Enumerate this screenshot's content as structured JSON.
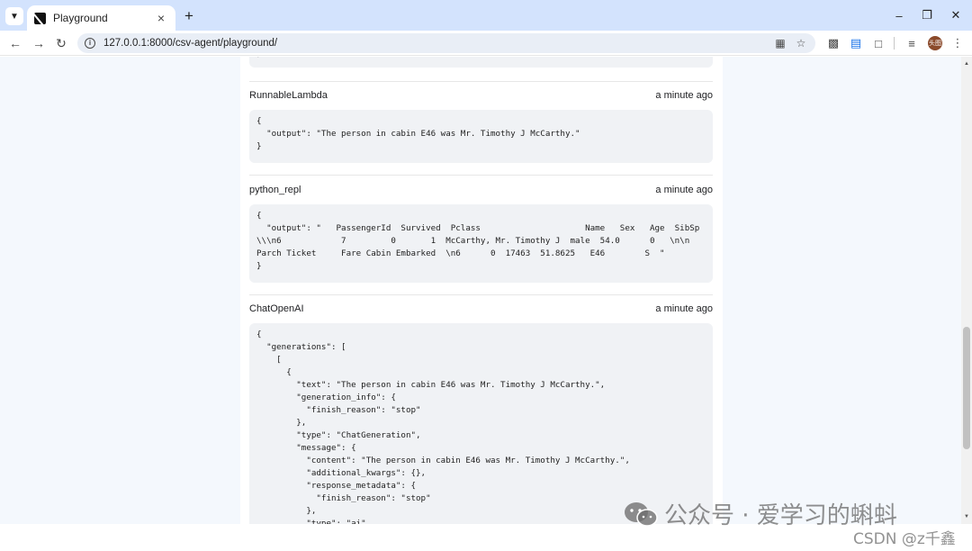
{
  "browser": {
    "tab_title": "Playground",
    "tab_close": "×",
    "new_tab": "+",
    "url": "127.0.0.1:8000/csv-agent/playground/",
    "avatar_text": "头图",
    "window_controls": {
      "minimize": "–",
      "restore": "❐",
      "close": "✕"
    }
  },
  "top_code_tail": "}",
  "runs": [
    {
      "name": "RunnableLambda",
      "time": "a minute ago",
      "code": "{\n  \"output\": \"The person in cabin E46 was Mr. Timothy J McCarthy.\"\n}"
    },
    {
      "name": "python_repl",
      "time": "a minute ago",
      "code": "{\n  \"output\": \"   PassengerId  Survived  Pclass                     Name   Sex   Age  SibSp\n\\\\\\n6            7         0       1  McCarthy, Mr. Timothy J  male  54.0      0   \\n\\n\nParch Ticket     Fare Cabin Embarked  \\n6      0  17463  51.8625   E46        S  \"\n}"
    },
    {
      "name": "ChatOpenAI",
      "time": "a minute ago",
      "code": "{\n  \"generations\": [\n    [\n      {\n        \"text\": \"The person in cabin E46 was Mr. Timothy J McCarthy.\",\n        \"generation_info\": {\n          \"finish_reason\": \"stop\"\n        },\n        \"type\": \"ChatGeneration\",\n        \"message\": {\n          \"content\": \"The person in cabin E46 was Mr. Timothy J McCarthy.\",\n          \"additional_kwargs\": {},\n          \"response_metadata\": {\n            \"finish_reason\": \"stop\"\n          },\n          \"type\": \"ai\","
    }
  ],
  "watermark": {
    "main": "公众号 · 爱学习的蝌蚪",
    "sub": "CSDN @z千鑫"
  }
}
